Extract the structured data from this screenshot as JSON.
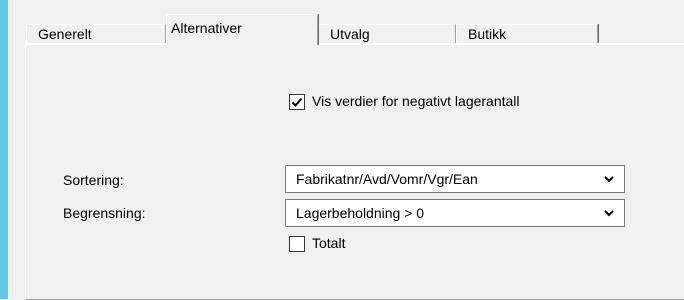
{
  "tabs": [
    {
      "label": "Generelt",
      "active": false
    },
    {
      "label": "Alternativer",
      "active": true
    },
    {
      "label": "Utvalg",
      "active": false
    },
    {
      "label": "Butikk",
      "active": false
    }
  ],
  "options": {
    "show_negative_label": "Vis verdier for negativt lagerantall",
    "show_negative_checked": true,
    "sorting_label": "Sortering:",
    "sorting_value": "Fabrikatnr/Avd/Vomr/Vgr/Ean",
    "limit_label": "Begrensning:",
    "limit_value": "Lagerbeholdning > 0",
    "total_label": "Totalt",
    "total_checked": false
  },
  "colors": {
    "accent": "#5ec8e6",
    "background": "#f0f0f0"
  },
  "icons": {
    "dropdown": "chevron-down-icon",
    "check": "check-icon"
  }
}
